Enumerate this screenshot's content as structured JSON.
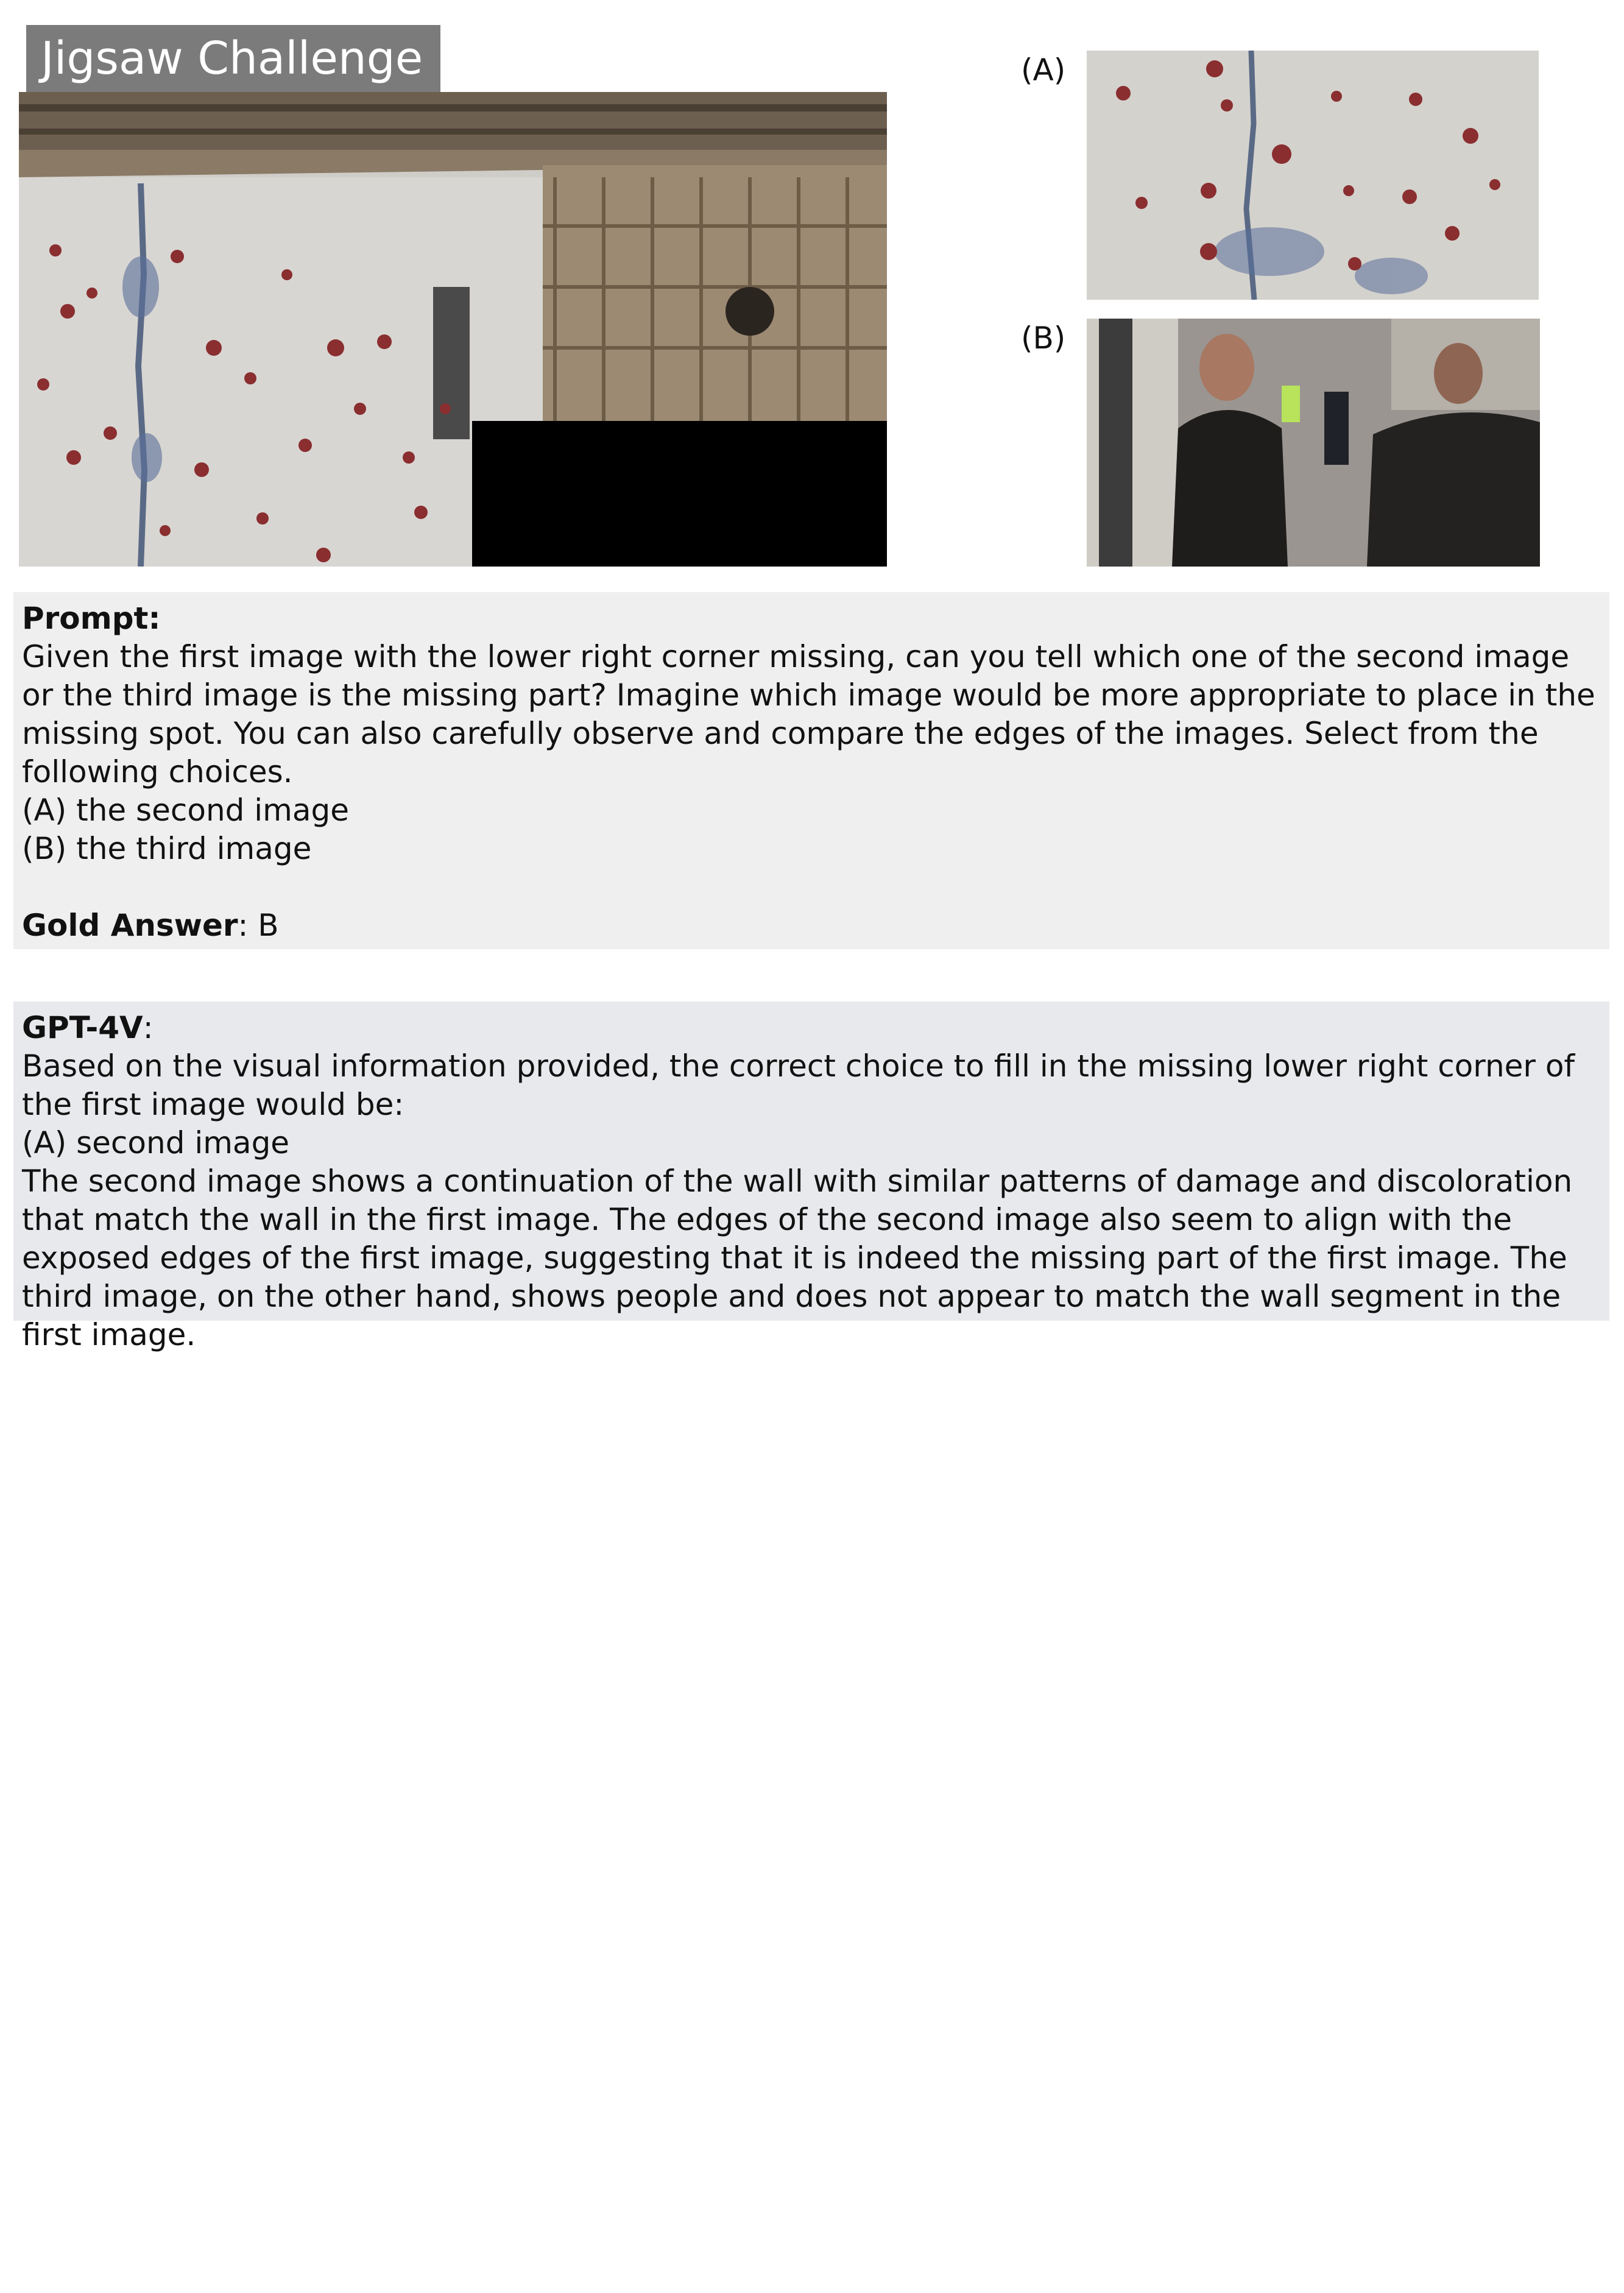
{
  "header": {
    "title": "Jigsaw Challenge"
  },
  "choices": {
    "a_label": "(A)",
    "b_label": "(B)"
  },
  "prompt": {
    "heading": "Prompt:",
    "text": "Given the first image with the lower right corner missing, can you tell which one of the second image or the third image is the missing part? Imagine which image would be more appropriate to place in the missing spot. You can also carefully observe and compare the edges of the images. Select from the following choices.",
    "option_a": "(A) the second image",
    "option_b": "(B) the third image",
    "gold_label": "Gold Answer",
    "gold_value": ": B"
  },
  "response": {
    "model_label": "GPT-4V",
    "model_suffix": ":",
    "line1": "Based on the visual information provided, the correct choice to fill in the missing lower right corner of the first image would be:",
    "line2": "(A) second image",
    "line3": "The second image shows a continuation of the wall with similar patterns of damage and discoloration that match the wall in the first image. The edges of the second image also seem to align with the exposed edges of the first image, suggesting that it is indeed the missing part of the first image. The third image, on the other hand, shows people and does not appear to match the wall segment in the first image."
  },
  "colors": {
    "title_bg": "#7b7b7b",
    "prompt_bg": "#efefef",
    "response_bg": "#e7e9ec",
    "missing": "#000000"
  }
}
